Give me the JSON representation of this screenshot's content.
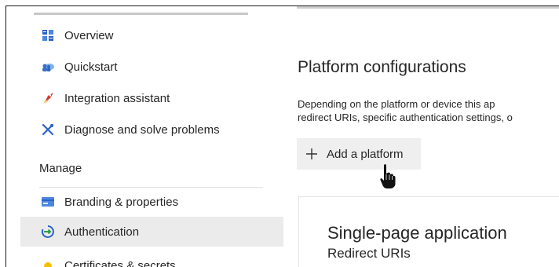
{
  "sidebar": {
    "items": [
      {
        "label": "Overview",
        "icon": "grid-icon"
      },
      {
        "label": "Quickstart",
        "icon": "cloud-people-icon"
      },
      {
        "label": "Integration assistant",
        "icon": "rocket-icon"
      },
      {
        "label": "Diagnose and solve problems",
        "icon": "wrench-cross-icon"
      }
    ],
    "section": "Manage",
    "manage_items": [
      {
        "label": "Branding & properties",
        "icon": "card-icon"
      },
      {
        "label": "Authentication",
        "icon": "authentication-icon",
        "active": true
      },
      {
        "label": "Certificates & secrets",
        "icon": "key-icon"
      }
    ]
  },
  "main": {
    "title": "Platform configurations",
    "description_line1": "Depending on the platform or device this ap",
    "description_line2": "redirect URIs, specific authentication settings, o",
    "add_button_label": "Add a platform",
    "card": {
      "title": "Single-page application",
      "subtitle": "Redirect URIs"
    }
  },
  "colors": {
    "active_item_bg": "#ebebeb",
    "button_bg": "#efefef",
    "icon_blue": "#2b63c9",
    "text": "#262626"
  }
}
